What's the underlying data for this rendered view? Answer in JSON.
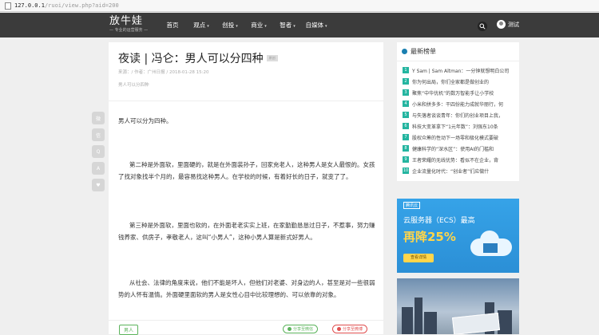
{
  "browser": {
    "url_host": "127.0.0.1",
    "url_path": "/ruoi/view.php?aid=200"
  },
  "nav": {
    "logo_title": "放牛娃",
    "logo_sub": "— 专业的运营服务 —",
    "menu": [
      {
        "label": "首页",
        "caret": false
      },
      {
        "label": "观点",
        "caret": true
      },
      {
        "label": "创投",
        "caret": true
      },
      {
        "label": "商业",
        "caret": true
      },
      {
        "label": "智者",
        "caret": true
      },
      {
        "label": "自媒体",
        "caret": true
      }
    ],
    "caret_glyph": "▾",
    "user_name": "测试"
  },
  "article": {
    "title": "夜读 | 冯仑：男人可以分四种",
    "tag_badge": "原创",
    "meta": "来源：/ 作者：广州日报 / 2018-01-28 15:20",
    "summary": "男人可以分四种",
    "paragraphs": [
      "男人可以分为四种。",
      "第二种是外面软，里面硬的，就是在外面装孙子，回家充老人，这种男人是女人最恨的。女孩了找对象找半个月的，最容易找这种男人。在学校的时候，有着好长的日子，就变了了。",
      "第三种是外面软，里面也软的，在外面老老实实上班，在家勤勤恳恳过日子，不惹事，努力赚钱养家、供房子，孝敬老人，这叫“小男人”，这种小男人算是新式好男人。",
      "从社会、法律的角度来说，他们不能是坏人，但他们对老婆、对身边的人，甚至是对一些很弱势的人怀有温情。外面硬里面软的男人是女性心目中比较理想的、可以依靠的对象。"
    ],
    "tag": "男人",
    "share_wechat": "分享至微信",
    "share_weibo": "分享至微博"
  },
  "share_bar": [
    {
      "name": "weibo-icon",
      "glyph": "微"
    },
    {
      "name": "wechat-icon",
      "glyph": "信"
    },
    {
      "name": "qq-icon",
      "glyph": "Q"
    },
    {
      "name": "font-size-icon",
      "glyph": "A"
    },
    {
      "name": "like-icon",
      "glyph": "♥"
    }
  ],
  "sidebar": {
    "hot_title": "最新榜单",
    "hot_list": [
      {
        "num": "1",
        "text": "Y Sam | Sam Altman：一分钟就想明白公司"
      },
      {
        "num": "2",
        "text": "你为何出局，你们全家都是做创业的"
      },
      {
        "num": "3",
        "text": "聚焦“中华优机”的数万智能手让小学校"
      },
      {
        "num": "4",
        "text": "小米和拼多多：干四份能力成就华丽行，何"
      },
      {
        "num": "5",
        "text": "与失落者谈谈青年：你们的创业项目上我，"
      },
      {
        "num": "6",
        "text": "科技大变革拿下“1元年数”：刘强东10条"
      },
      {
        "num": "7",
        "text": "股权众筹的性动下一场零和极化模式要破"
      },
      {
        "num": "8",
        "text": "健康科学的“深水区”：使用AI的门槛和"
      },
      {
        "num": "9",
        "text": "王者荣耀的无线优势：看似不在企业，背"
      },
      {
        "num": "10",
        "text": "企业流量化时代：“创业者”们应做什"
      }
    ]
  },
  "ad1": {
    "logo": "腾讯云",
    "title": "云服务器（ECS）最高",
    "big": "再降25%",
    "button": "查看详情"
  },
  "colors": {
    "nav_bg": "#3b3b3b",
    "accent_green": "#24b5a0",
    "share_green": "#5bb35b",
    "share_red": "#e04f4f"
  }
}
